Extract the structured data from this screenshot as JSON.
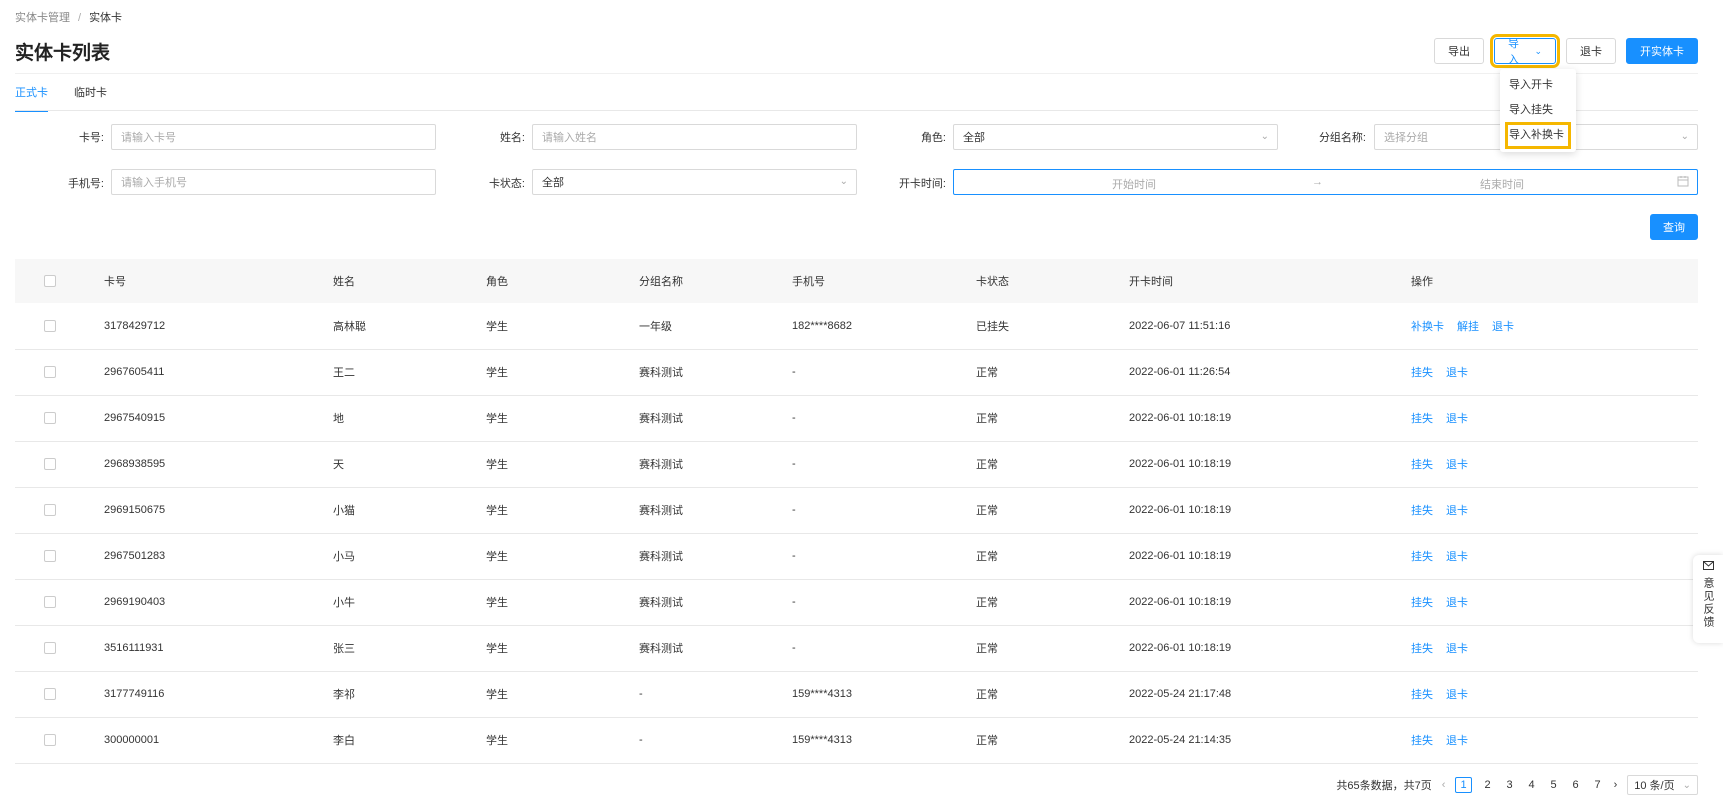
{
  "breadcrumb": {
    "parent": "实体卡管理",
    "separator": "/",
    "current": "实体卡"
  },
  "page_title": "实体卡列表",
  "header_buttons": {
    "export": "导出",
    "import": "导入",
    "return_card": "退卡",
    "open_card": "开实体卡"
  },
  "import_menu": [
    "导入开卡",
    "导入挂失",
    "导入补换卡"
  ],
  "tabs": [
    "正式卡",
    "临时卡"
  ],
  "filters": {
    "card_no": {
      "label": "卡号:",
      "placeholder": "请输入卡号"
    },
    "name": {
      "label": "姓名:",
      "placeholder": "请输入姓名"
    },
    "role": {
      "label": "角色:",
      "value": "全部"
    },
    "group": {
      "label": "分组名称:",
      "placeholder": "选择分组"
    },
    "phone": {
      "label": "手机号:",
      "placeholder": "请输入手机号"
    },
    "card_status": {
      "label": "卡状态:",
      "value": "全部"
    },
    "open_time": {
      "label": "开卡时间:",
      "start": "开始时间",
      "end": "结束时间",
      "arrow": "→"
    }
  },
  "query_button": "查询",
  "table": {
    "headers": [
      "卡号",
      "姓名",
      "角色",
      "分组名称",
      "手机号",
      "卡状态",
      "开卡时间",
      "操作"
    ],
    "rows": [
      [
        "3178429712",
        "高林聪",
        "学生",
        "一年级",
        "182****8682",
        "已挂失",
        "2022-06-07 11:51:16",
        [
          "补换卡",
          "解挂",
          "退卡"
        ]
      ],
      [
        "2967605411",
        "王二",
        "学生",
        "赛科测试",
        "-",
        "正常",
        "2022-06-01 11:26:54",
        [
          "挂失",
          "退卡"
        ]
      ],
      [
        "2967540915",
        "地",
        "学生",
        "赛科测试",
        "-",
        "正常",
        "2022-06-01 10:18:19",
        [
          "挂失",
          "退卡"
        ]
      ],
      [
        "2968938595",
        "天",
        "学生",
        "赛科测试",
        "-",
        "正常",
        "2022-06-01 10:18:19",
        [
          "挂失",
          "退卡"
        ]
      ],
      [
        "2969150675",
        "小猫",
        "学生",
        "赛科测试",
        "-",
        "正常",
        "2022-06-01 10:18:19",
        [
          "挂失",
          "退卡"
        ]
      ],
      [
        "2967501283",
        "小马",
        "学生",
        "赛科测试",
        "-",
        "正常",
        "2022-06-01 10:18:19",
        [
          "挂失",
          "退卡"
        ]
      ],
      [
        "2969190403",
        "小牛",
        "学生",
        "赛科测试",
        "-",
        "正常",
        "2022-06-01 10:18:19",
        [
          "挂失",
          "退卡"
        ]
      ],
      [
        "3516111931",
        "张三",
        "学生",
        "赛科测试",
        "-",
        "正常",
        "2022-06-01 10:18:19",
        [
          "挂失",
          "退卡"
        ]
      ],
      [
        "3177749116",
        "李祁",
        "学生",
        "-",
        "159****4313",
        "正常",
        "2022-05-24 21:17:48",
        [
          "挂失",
          "退卡"
        ]
      ],
      [
        "300000001",
        "李白",
        "学生",
        "-",
        "159****4313",
        "正常",
        "2022-05-24 21:14:35",
        [
          "挂失",
          "退卡"
        ]
      ]
    ]
  },
  "pagination": {
    "summary": "共65条数据，共7页",
    "pages": [
      "1",
      "2",
      "3",
      "4",
      "5",
      "6",
      "7"
    ],
    "current": "1",
    "page_size": "10 条/页"
  },
  "feedback": "意见反馈",
  "colors": {
    "primary": "#1890ff",
    "highlight": "#f5b700"
  }
}
